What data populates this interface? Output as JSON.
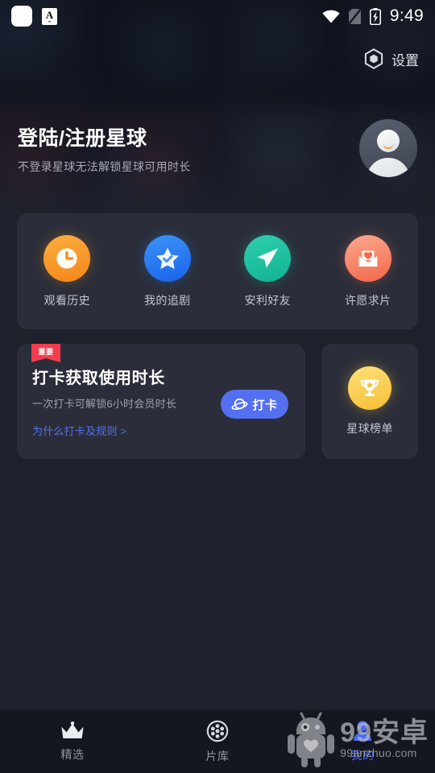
{
  "statusbar": {
    "time": "9:49",
    "icons": [
      "notification-square-icon",
      "app-badge-a-icon",
      "wifi-icon",
      "sim-card-off-icon",
      "battery-charging-icon"
    ],
    "badge_letter": "A"
  },
  "header": {
    "settings_label": "设置",
    "settings_icon": "hexagon-gear-icon"
  },
  "account": {
    "title": "登陆/注册星球",
    "subtitle": "不登录星球无法解锁星球可用时长",
    "avatar_icon": "default-user-avatar"
  },
  "quick_actions": [
    {
      "label": "观看历史",
      "icon": "clock-icon",
      "color": "#F4861A"
    },
    {
      "label": "我的追剧",
      "icon": "star-check-icon",
      "color": "#1A63EA"
    },
    {
      "label": "安利好友",
      "icon": "paper-plane-icon",
      "color": "#12B392"
    },
    {
      "label": "许愿求片",
      "icon": "envelope-heart-icon",
      "color": "#F4674A"
    }
  ],
  "checkin": {
    "badge": "重要",
    "badge_color": "#F33D4E",
    "title": "打卡获取使用时长",
    "subtitle": "一次打卡可解锁6小时会员时长",
    "link": "为什么打卡及规则 >",
    "button_label": "打卡",
    "button_icon": "planet-icon",
    "button_color": "#5470F0"
  },
  "rank": {
    "label": "星球榜单",
    "icon": "trophy-icon",
    "color": "#F6BF35"
  },
  "bottom_nav": {
    "items": [
      {
        "label": "精选",
        "icon": "crown-icon",
        "active": false
      },
      {
        "label": "片库",
        "icon": "film-reel-icon",
        "active": false
      },
      {
        "label": "我的",
        "icon": "person-icon",
        "active": true
      }
    ],
    "active_color": "#4A6BF5",
    "inactive_color": "#9296A2"
  },
  "watermark": {
    "main": "99安卓",
    "sub": "99anzhuo.com",
    "mascot_icon": "android-robot-mascot-icon"
  }
}
